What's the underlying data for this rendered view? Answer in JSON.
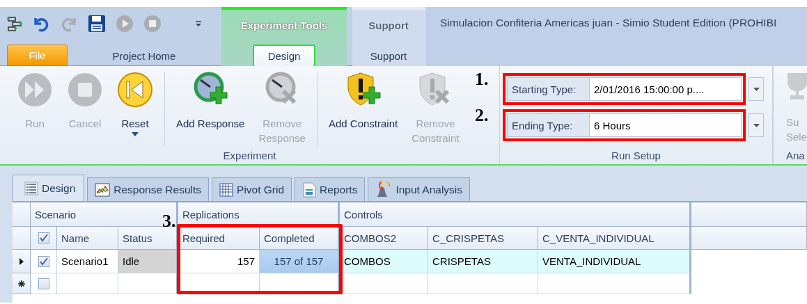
{
  "quick_access": [
    {
      "kind": "tree",
      "disabled": false
    },
    {
      "kind": "undo",
      "disabled": false
    },
    {
      "kind": "redo",
      "disabled": true
    },
    {
      "kind": "save",
      "disabled": false
    },
    {
      "kind": "play",
      "disabled": true
    },
    {
      "kind": "stop",
      "disabled": true
    },
    {
      "kind": "customize",
      "disabled": false
    }
  ],
  "ribbon_tabs": [
    {
      "label": "File",
      "kind": "file",
      "selected": false
    },
    {
      "label": "Project Home",
      "kind": "tab",
      "selected": false
    }
  ],
  "context_groups": [
    {
      "title": "Experiment Tools",
      "kind": "experiment",
      "tabs": [
        {
          "label": "Design",
          "selected": true
        }
      ]
    },
    {
      "title": "Support",
      "kind": "plain",
      "tabs": [
        {
          "label": "Support",
          "selected": false
        }
      ]
    }
  ],
  "window": {
    "title": "Simulacion Confiteria Americas juan - Simio Student Edition (PROHIBI"
  },
  "experiment_group": {
    "label": "Experiment",
    "sections": [
      {
        "buttons": [
          {
            "label": "Run",
            "kind": "run",
            "disabled": true,
            "dropdown": false
          },
          {
            "label": "Cancel",
            "kind": "cancel",
            "disabled": true,
            "dropdown": false
          },
          {
            "label": "Reset",
            "kind": "reset",
            "disabled": false,
            "dropdown": true
          }
        ]
      },
      {
        "buttons": [
          {
            "label": "Add Response",
            "kind": "add-response",
            "disabled": false,
            "dropdown": false
          },
          {
            "label": "Remove\nResponse",
            "kind": "remove-response",
            "disabled": true,
            "dropdown": false
          }
        ]
      },
      {
        "buttons": [
          {
            "label": "Add Constraint",
            "kind": "add-constraint",
            "disabled": false,
            "dropdown": false
          },
          {
            "label": "Remove\nConstraint",
            "kind": "remove-constraint",
            "disabled": true,
            "dropdown": false
          }
        ]
      }
    ]
  },
  "run_setup": {
    "label": "Run Setup",
    "fields": [
      {
        "marker": "1.",
        "label": "Starting Type:",
        "value": "2/01/2016 15:00:00 p....",
        "highlighted": true
      },
      {
        "marker": "2.",
        "label": "Ending Type:",
        "value": "6 Hours",
        "highlighted": true
      }
    ]
  },
  "analysis_group": {
    "label": "Ana",
    "button": {
      "label": "Su\nSele",
      "disabled": true
    }
  },
  "view_tabs": [
    {
      "label": "Design",
      "kind": "design",
      "selected": true
    },
    {
      "label": "Response Results",
      "kind": "results",
      "selected": false
    },
    {
      "label": "Pivot Grid",
      "kind": "pivot",
      "selected": false
    },
    {
      "label": "Reports",
      "kind": "reports",
      "selected": false
    },
    {
      "label": "Input Analysis",
      "kind": "analysis",
      "selected": false
    }
  ],
  "grid": {
    "marker": "3.",
    "header_checked": true,
    "bands": [
      {
        "label": "Scenario",
        "columns": [
          {
            "label": "Name",
            "kind": "text"
          },
          {
            "label": "Status",
            "kind": "readonly"
          }
        ]
      },
      {
        "label": "Replications",
        "columns": [
          {
            "label": "Required",
            "kind": "number"
          },
          {
            "label": "Completed",
            "kind": "progress"
          }
        ]
      },
      {
        "label": "Controls",
        "columns": [
          {
            "label": "COMBOS2",
            "kind": "control"
          },
          {
            "label": "C_CRISPETAS",
            "kind": "control"
          },
          {
            "label": "C_VENTA_INDIVIDUAL",
            "kind": "control"
          }
        ]
      }
    ],
    "rows": [
      {
        "kind": "current",
        "checked": true,
        "cells": [
          {
            "text": "Scenario1",
            "selected": false
          },
          {
            "text": "Idle",
            "selected": false
          },
          {
            "text": "157",
            "selected": false
          },
          {
            "text": "157 of 157",
            "selected": true
          },
          {
            "text": "COMBOS",
            "selected": false
          },
          {
            "text": "CRISPETAS",
            "selected": false
          },
          {
            "text": "VENTA_INDIVIDUAL",
            "selected": false
          }
        ]
      },
      {
        "kind": "new",
        "checked": false
      }
    ]
  }
}
